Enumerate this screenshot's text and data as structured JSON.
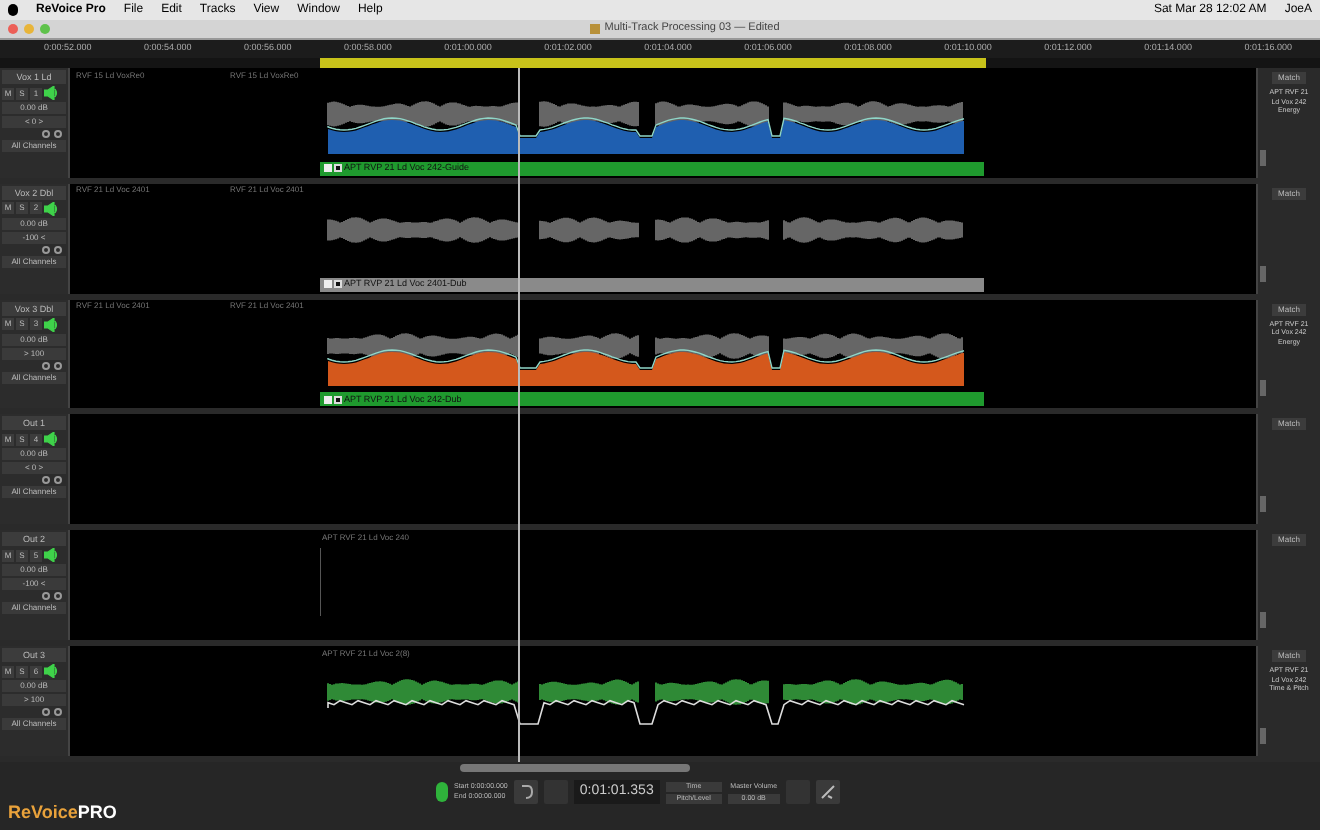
{
  "menu_bar": {
    "app": "ReVoice Pro",
    "items": [
      "File",
      "Edit",
      "Tracks",
      "View",
      "Window",
      "Help"
    ],
    "clock": "Sat Mar 28 12:02 AM",
    "user": "JoeA"
  },
  "window": {
    "title": "Multi-Track Processing 03 — Edited"
  },
  "ruler": {
    "ticks": [
      "0:00:52.000",
      "0:00:54.000",
      "0:00:56.000",
      "0:00:58.000",
      "0:01:00.000",
      "0:01:02.000",
      "0:01:04.000",
      "0:01:06.000",
      "0:01:08.000",
      "0:01:10.000",
      "0:01:12.000",
      "0:01:14.000",
      "0:01:16.000"
    ]
  },
  "tracks": [
    {
      "name": "Vox 1 Ld",
      "mute": "M",
      "solo": "S",
      "number": "1",
      "gain": "0.00 dB",
      "pan": "< 0 >",
      "channels": "All Channels",
      "region_labels": [
        "RVF 15 Ld VoxRe0",
        "RVF 15 Ld VoxRe0"
      ],
      "clip": {
        "label": "APT RVP 21 Ld Voc 242-Guide",
        "color": "#1f9a2e",
        "overlay": {
          "color": "#1f5fb0"
        }
      },
      "match": "Match",
      "process": "APT RVF 21 Ld Vox 242 Energy"
    },
    {
      "name": "Vox 2 Dbl",
      "mute": "M",
      "solo": "S",
      "number": "2",
      "gain": "0.00 dB",
      "pan": "-100 <",
      "channels": "All Channels",
      "region_labels": [
        "RVF 21 Ld Voc 2401",
        "RVF 21 Ld Voc 2401"
      ],
      "clip": {
        "label": "APT RVP 21 Ld Voc 2401-Dub",
        "color": "#8a8a8a"
      },
      "match": "Match"
    },
    {
      "name": "Vox 3 Dbl",
      "mute": "M",
      "solo": "S",
      "number": "3",
      "gain": "0.00 dB",
      "pan": "> 100",
      "channels": "All Channels",
      "region_labels": [
        "RVF 21 Ld Voc 2401",
        "RVF 21 Ld Voc 2401"
      ],
      "clip": {
        "label": "APT RVP 21 Ld Voc 242-Dub",
        "color": "#1f9a2e",
        "overlay": {
          "color": "#d4581c"
        }
      },
      "match": "Match",
      "process": "APT RVF 21 Ld Vox 242 Energy"
    },
    {
      "name": "Out 1",
      "mute": "M",
      "solo": "S",
      "number": "4",
      "gain": "0.00 dB",
      "pan": "< 0 >",
      "channels": "All Channels",
      "match": "Match"
    },
    {
      "name": "Out 2",
      "mute": "M",
      "solo": "S",
      "number": "5",
      "gain": "0.00 dB",
      "pan": "-100 <",
      "channels": "All Channels",
      "output": {
        "label": "APT RVF 21 Ld Voc 240"
      },
      "match": "Match"
    },
    {
      "name": "Out 3",
      "mute": "M",
      "solo": "S",
      "number": "6",
      "gain": "0.00 dB",
      "pan": "> 100",
      "channels": "All Channels",
      "output": {
        "label": "APT RVF 21 Ld Voc 2(8)",
        "wave": {
          "color": "#2f8a36"
        }
      },
      "match": "Match",
      "process": "APT RVF 21 Ld Vox 242 Time & Pitch"
    }
  ],
  "transport": {
    "logo_main": "ReVoice",
    "logo_accent": "PRO",
    "start": "Start 0:00:00.000",
    "end": "End 0:00:00.000",
    "time": "0:01:01.353",
    "mode": "Time",
    "view": "Pitch/Level",
    "volume_label": "Master Volume",
    "volume": "0.00 dB"
  }
}
